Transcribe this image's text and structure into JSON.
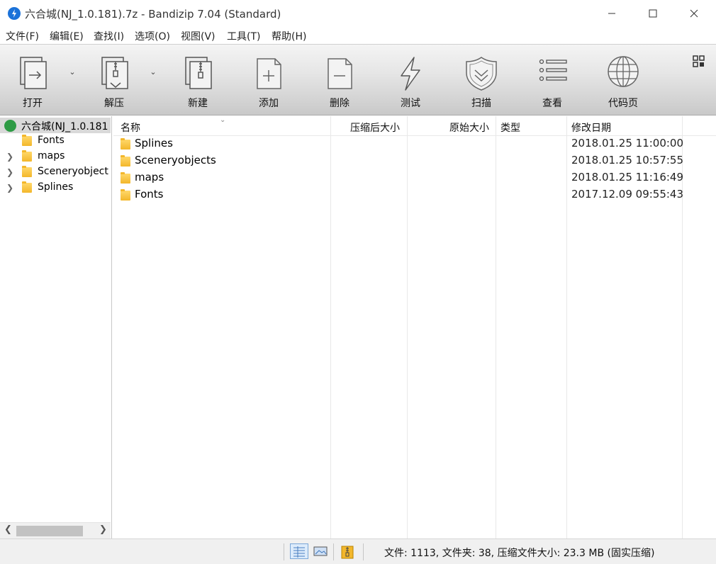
{
  "window": {
    "title": "六合城(NJ_1.0.181).7z - Bandizip 7.04 (Standard)"
  },
  "menu": [
    {
      "label": "文件(F)"
    },
    {
      "label": "编辑(E)"
    },
    {
      "label": "查找(I)"
    },
    {
      "label": "选项(O)"
    },
    {
      "label": "视图(V)"
    },
    {
      "label": "工具(T)"
    },
    {
      "label": "帮助(H)"
    }
  ],
  "toolbar": [
    {
      "label": "打开",
      "icon": "open-icon",
      "dropdown": true
    },
    {
      "label": "解压",
      "icon": "extract-icon",
      "dropdown": true
    },
    {
      "label": "新建",
      "icon": "new-archive-icon"
    },
    {
      "label": "添加",
      "icon": "add-file-icon"
    },
    {
      "label": "删除",
      "icon": "delete-file-icon"
    },
    {
      "label": "测试",
      "icon": "test-bolt-icon"
    },
    {
      "label": "扫描",
      "icon": "scan-shield-icon"
    },
    {
      "label": "查看",
      "icon": "view-list-icon"
    },
    {
      "label": "代码页",
      "icon": "codepage-globe-icon"
    }
  ],
  "tree": {
    "root": "六合城(NJ_1.0.181",
    "children": [
      "Fonts",
      "maps",
      "Sceneryobject",
      "Splines"
    ]
  },
  "columns": {
    "name": "名称",
    "compressed": "压缩后大小",
    "original": "原始大小",
    "type": "类型",
    "modified": "修改日期"
  },
  "files": [
    {
      "name": "Splines",
      "modified": "2018.01.25 11:00:00"
    },
    {
      "name": "Sceneryobjects",
      "modified": "2018.01.25 10:57:55"
    },
    {
      "name": "maps",
      "modified": "2018.01.25 11:16:49"
    },
    {
      "name": "Fonts",
      "modified": "2017.12.09 09:55:43"
    }
  ],
  "status": {
    "text": "文件: 1113, 文件夹: 38, 压缩文件大小: 23.3 MB (固实压缩)"
  },
  "colors": {
    "folder": "#f3b72b",
    "app_icon": "#1b72d9",
    "archive_icon": "#2e9b45"
  }
}
